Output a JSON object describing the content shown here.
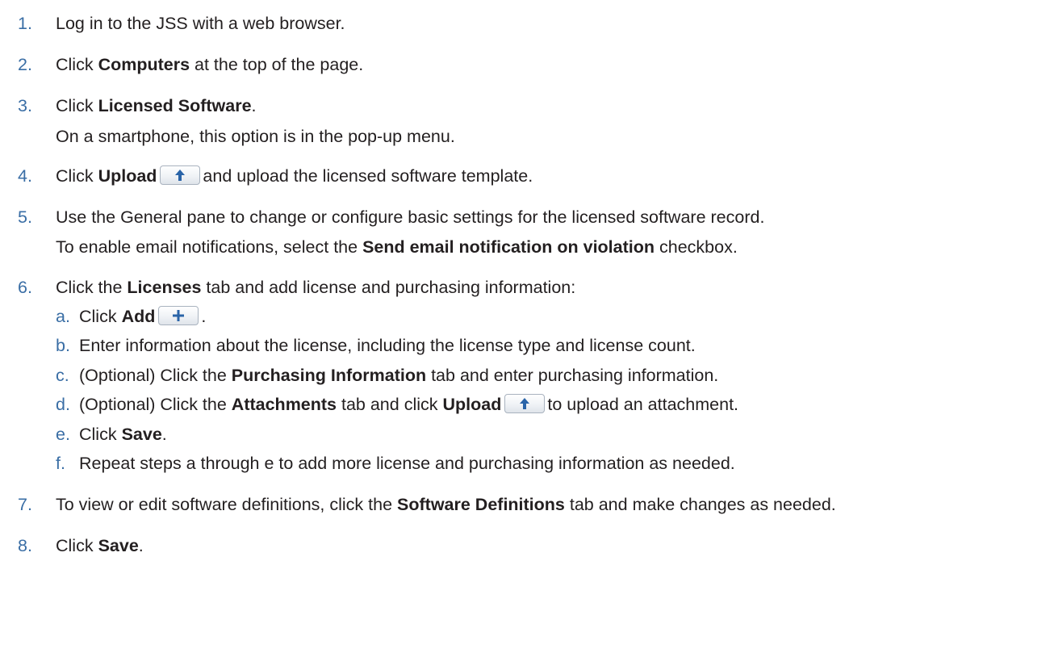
{
  "steps": [
    {
      "num": "1.",
      "a": "Log in to the JSS with a web browser."
    },
    {
      "num": "2.",
      "a": "Click ",
      "b": "Computers",
      "c": " at the top of the page."
    },
    {
      "num": "3.",
      "a": "Click ",
      "b": "Licensed Software",
      "c": ".",
      "note": "On a smartphone, this option is in the pop-up menu."
    },
    {
      "num": "4.",
      "a": "Click ",
      "b": "Upload",
      "c": "and upload the licensed software template.",
      "icon": "upload-arrow-icon"
    },
    {
      "num": "5.",
      "a": "Use the General pane to change or configure basic settings for the licensed software record.",
      "note_a": "To enable email notifications, select the ",
      "note_b": "Send email notification on violation",
      "note_c": " checkbox."
    },
    {
      "num": "6.",
      "a": "Click the ",
      "b": "Licenses",
      "c": " tab and add license and purchasing information:"
    },
    {
      "num": "7.",
      "a": "To view or edit software definitions, click the ",
      "b": "Software Definitions",
      "c": " tab and make changes as needed."
    },
    {
      "num": "8.",
      "a": "Click ",
      "b": "Save",
      "c": "."
    }
  ],
  "substeps": [
    {
      "letter": "a.",
      "a": "Click ",
      "b": "Add",
      "c": ".",
      "icon": "plus-icon"
    },
    {
      "letter": "b.",
      "a": "Enter information about the license, including the license type and license count."
    },
    {
      "letter": "c.",
      "a": "(Optional) Click the ",
      "b": "Purchasing Information",
      "c": " tab and enter purchasing information."
    },
    {
      "letter": "d.",
      "a": "(Optional) Click the ",
      "b": "Attachments",
      "c": " tab and click ",
      "d": "Upload",
      "e": "to upload an attachment.",
      "icon": "upload-arrow-icon"
    },
    {
      "letter": "e.",
      "a": "Click ",
      "b": "Save",
      "c": "."
    },
    {
      "letter": "f.",
      "a": "Repeat steps a through e to add more license and purchasing information as needed."
    }
  ],
  "colors": {
    "number": "#3a6ea5",
    "icon": "#2a64a8",
    "text": "#231f20"
  }
}
